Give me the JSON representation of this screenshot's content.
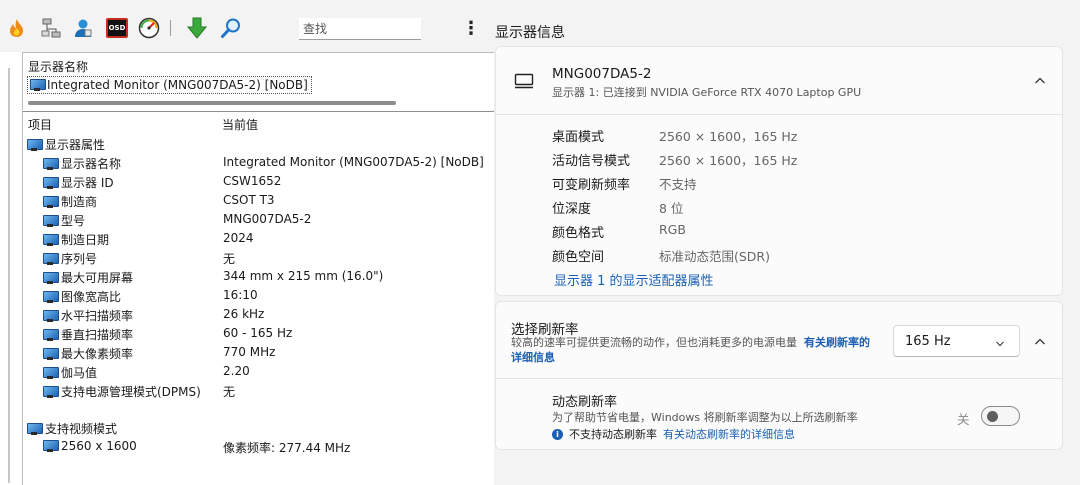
{
  "toolbar": {
    "icons": [
      "flame-icon",
      "network-icon",
      "user-icon",
      "osd-icon",
      "gauge-icon",
      "download-icon",
      "search-icon"
    ],
    "osd_text": "OSD",
    "search_placeholder": "查找",
    "menu_glyph": "⋮"
  },
  "display_names": {
    "title": "显示器名称",
    "item": "Integrated Monitor (MNG007DA5-2) [NoDB]"
  },
  "props": {
    "col_item": "项目",
    "col_value": "当前值",
    "group1": "显示器属性",
    "rows": [
      {
        "k": "显示器名称",
        "v": "Integrated Monitor (MNG007DA5-2) [NoDB]"
      },
      {
        "k": "显示器 ID",
        "v": "CSW1652"
      },
      {
        "k": "制造商",
        "v": "CSOT T3"
      },
      {
        "k": "型号",
        "v": "MNG007DA5-2"
      },
      {
        "k": "制造日期",
        "v": "2024"
      },
      {
        "k": "序列号",
        "v": "无"
      },
      {
        "k": "最大可用屏幕",
        "v": "344 mm x 215 mm (16.0\")"
      },
      {
        "k": "图像宽高比",
        "v": "16:10"
      },
      {
        "k": "水平扫描频率",
        "v": "26 kHz"
      },
      {
        "k": "垂直扫描频率",
        "v": "60 - 165 Hz"
      },
      {
        "k": "最大像素频率",
        "v": "770 MHz"
      },
      {
        "k": "伽马值",
        "v": "2.20"
      },
      {
        "k": "支持电源管理模式(DPMS)",
        "v": "无"
      }
    ],
    "group2": "支持视频模式",
    "mode": {
      "k": "2560 x 1600",
      "v": "像素频率: 277.44 MHz"
    }
  },
  "right": {
    "title": "显示器信息",
    "monitor_name": "MNG007DA5-2",
    "monitor_sub": "显示器 1: 已连接到 NVIDIA GeForce RTX 4070 Laptop GPU",
    "details": [
      {
        "k": "桌面模式",
        "v": "2560 × 1600，165 Hz"
      },
      {
        "k": "活动信号模式",
        "v": "2560 × 1600，165 Hz"
      },
      {
        "k": "可变刷新频率",
        "v": "不支持"
      },
      {
        "k": "位深度",
        "v": "8 位"
      },
      {
        "k": "颜色格式",
        "v": "RGB"
      },
      {
        "k": "颜色空间",
        "v": "标准动态范围(SDR)"
      }
    ],
    "adapter_link": "显示器 1 的显示适配器属性",
    "refresh": {
      "title": "选择刷新率",
      "desc": "较高的速率可提供更流畅的动作，但也消耗更多的电源电量",
      "desc_link": "有关刷新率的详细信息",
      "selected": "165 Hz"
    },
    "dynamic": {
      "title": "动态刷新率",
      "desc": "为了帮助节省电量，Windows 将刷新率调整为以上所选刷新率",
      "info_text": "不支持动态刷新率",
      "info_link": "有关动态刷新率的详细信息",
      "toggle_label": "关",
      "toggle_on": false
    }
  }
}
